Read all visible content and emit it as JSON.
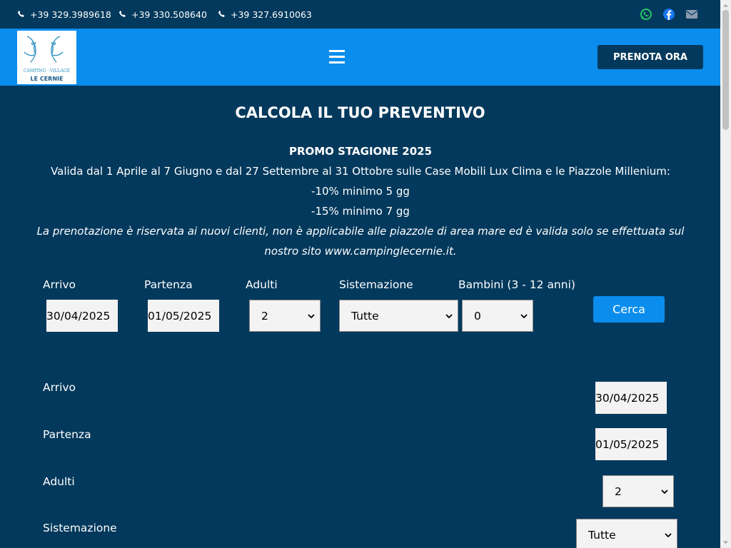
{
  "topbar": {
    "phones": [
      "+39 329.3989618",
      "+39 330.508640",
      "+39 327.6910063"
    ],
    "social_icons": [
      "whatsapp-icon",
      "facebook-icon",
      "envelope-icon"
    ],
    "colors": {
      "whatsapp": "#25d366",
      "facebook": "#1877f2",
      "envelope": "#8a9bb0"
    }
  },
  "header": {
    "logo_top_text": "CAMPING · VILLAGE",
    "logo_bottom_text": "LE CERNIE",
    "prenota_label": "PRENOTA ORA",
    "menu_icon": "hamburger-icon"
  },
  "main": {
    "title": "CALCOLA IL TUO PREVENTIVO",
    "promo_title": "PROMO STAGIONE 2025",
    "promo_line1": "Valida dal 1 Aprile al 7 Giugno e dal 27 Settembre al 31 Ottobre sulle Case Mobili Lux Clima e le Piazzole Millenium:",
    "promo_line2": "-10% minimo 5 gg",
    "promo_line3": "-15% minimo 7 gg",
    "promo_note": "La prenotazione è riservata ai nuovi clienti, non è applicabile alle piazzole di area mare ed è valida solo se effettuata sul nostro sito www.campinglecernie.it."
  },
  "form": {
    "arrivo_label": "Arrivo",
    "arrivo_value": "30/04/2025",
    "partenza_label": "Partenza",
    "partenza_value": "01/05/2025",
    "adulti_label": "Adulti",
    "adulti_value": "2",
    "sistemazione_label": "Sistemazione",
    "sistemazione_value": "Tutte",
    "bambini_label": "Bambini (3 - 12 anni)",
    "bambini_value": "0",
    "cerca_label": "Cerca"
  },
  "form_mobile": {
    "arrivo_label": "Arrivo",
    "arrivo_value": "30/04/2025",
    "partenza_label": "Partenza",
    "partenza_value": "01/05/2025",
    "adulti_label": "Adulti",
    "adulti_value": "2",
    "sistemazione_label": "Sistemazione",
    "sistemazione_value": "Tutte"
  },
  "colors": {
    "dark_blue": "#03395c",
    "bright_blue": "#0a8ded",
    "field_bg": "#f3f3f3"
  }
}
